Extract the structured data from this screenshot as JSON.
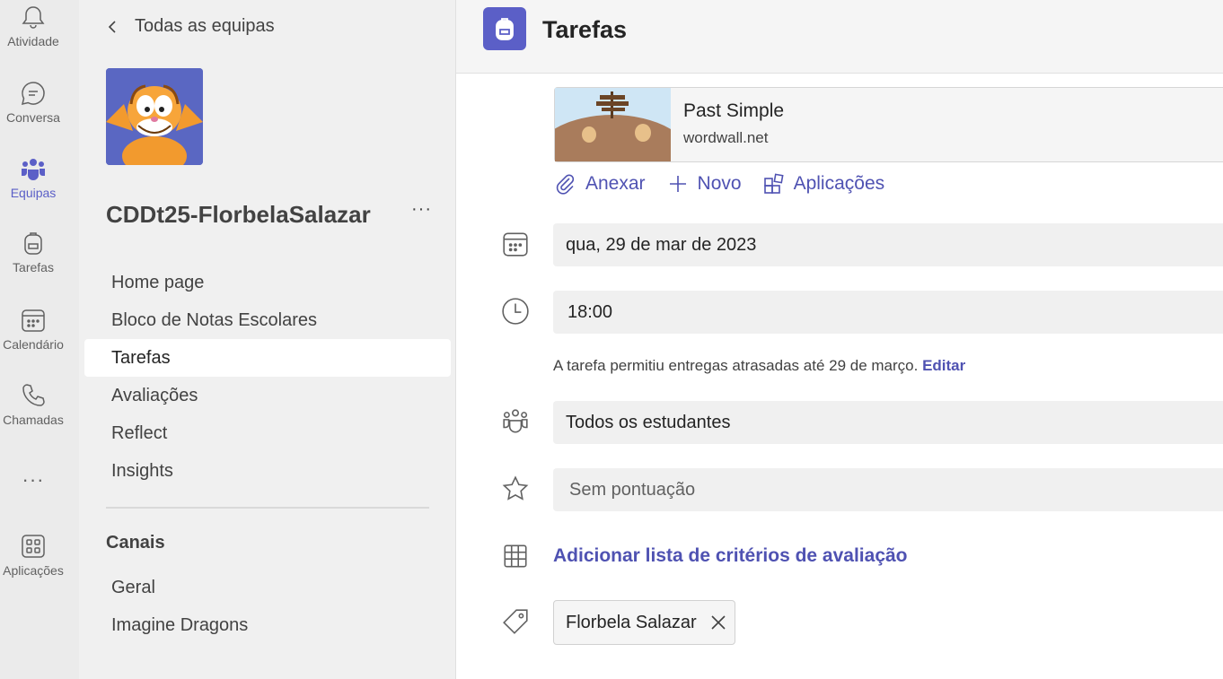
{
  "rail": {
    "items": [
      {
        "label": "Atividade",
        "icon": "bell-icon"
      },
      {
        "label": "Conversa",
        "icon": "chat-icon"
      },
      {
        "label": "Equipas",
        "icon": "teams-icon",
        "active": true
      },
      {
        "label": "Tarefas",
        "icon": "backpack-icon"
      },
      {
        "label": "Calendário",
        "icon": "calendar-icon"
      },
      {
        "label": "Chamadas",
        "icon": "phone-icon"
      },
      {
        "label": "Aplicações",
        "icon": "apps-icon"
      }
    ],
    "more": "···"
  },
  "sidebar": {
    "back_label": "Todas as equipas",
    "team_name": "CDDt25-FlorbelaSalazar",
    "more": "···",
    "nav": [
      {
        "label": "Home page"
      },
      {
        "label": "Bloco de Notas Escolares"
      },
      {
        "label": "Tarefas",
        "active": true
      },
      {
        "label": "Avaliações"
      },
      {
        "label": "Reflect"
      },
      {
        "label": "Insights"
      }
    ],
    "channels_heading": "Canais",
    "channels": [
      {
        "label": "Geral"
      },
      {
        "label": "Imagine Dragons"
      }
    ]
  },
  "header": {
    "title": "Tarefas"
  },
  "assignment": {
    "resource": {
      "title": "Past Simple",
      "source": "wordwall.net"
    },
    "actions": {
      "attach": "Anexar",
      "new": "Novo",
      "apps": "Aplicações"
    },
    "due_date": "qua, 29 de mar de 2023",
    "due_time": "18:00",
    "late_note": "A tarefa permitiu entregas atrasadas até 29 de março.",
    "late_edit": "Editar",
    "assign_to": "Todos os estudantes",
    "points_placeholder": "Sem pontuação",
    "rubric_link": "Adicionar lista de critérios de avaliação",
    "tag": "Florbela Salazar"
  },
  "colors": {
    "accent": "#5b5fc7",
    "link": "#4f52b2",
    "rail_bg": "#ebebeb",
    "sidebar_bg": "#f0f0f0"
  }
}
